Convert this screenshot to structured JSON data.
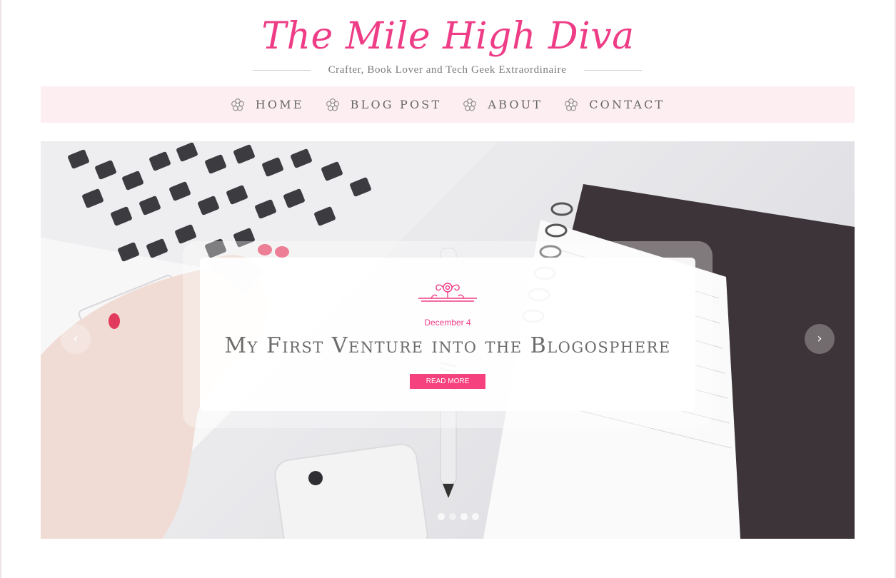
{
  "site": {
    "title": "The Mile High Diva",
    "tagline": "Crafter, Book Lover and Tech Geek Extraordinaire"
  },
  "nav": {
    "icon": "flower-icon",
    "items": [
      {
        "label": "HOME"
      },
      {
        "label": "BLOG POST"
      },
      {
        "label": "ABOUT"
      },
      {
        "label": "CONTACT"
      }
    ]
  },
  "slider": {
    "slide": {
      "date": "December 4",
      "title": "My First Venture into the Blogosphere",
      "button_label": "READ MORE"
    },
    "prev_icon": "‹",
    "next_icon": "›",
    "dot_count": 4,
    "active_dot": 1
  },
  "colors": {
    "accent": "#ee3d86",
    "button": "#f6417f",
    "nav_bg": "#fdeef1"
  }
}
